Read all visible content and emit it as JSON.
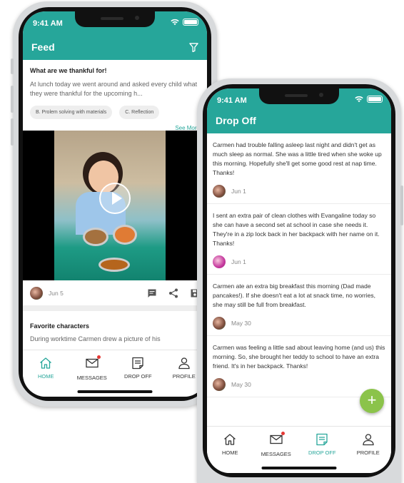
{
  "feed_phone": {
    "status": {
      "time": "9:41 AM"
    },
    "header": {
      "title": "Feed"
    },
    "post1": {
      "title": "What are we thankful for!",
      "body": "At lunch today we went around and asked every child what they were thankful for the upcoming h...",
      "chips": [
        "B. Prolem solving with materials",
        "C. Reflection"
      ],
      "see_more": "See More",
      "date": "Jun 5"
    },
    "post2": {
      "title": "Favorite characters",
      "body": "During worktime Carmen drew a picture of his"
    },
    "tabs": [
      {
        "label": "HOME",
        "icon": "home-icon",
        "active": true
      },
      {
        "label": "MESSAGES",
        "icon": "mail-icon",
        "active": false
      },
      {
        "label": "DROP OFF",
        "icon": "note-icon",
        "active": false
      },
      {
        "label": "PROFILE",
        "icon": "person-icon",
        "active": false
      }
    ]
  },
  "dropoff_phone": {
    "status": {
      "time": "9:41 AM"
    },
    "header": {
      "title": "Drop Off"
    },
    "notes": [
      {
        "text": "Carmen had trouble falling asleep last night and didn't get as much sleep as normal. She was a little tired when she woke up this morning. Hopefully she'll get some good rest at nap time. Thanks!",
        "date": "Jun 1"
      },
      {
        "text": "I sent an extra pair of clean clothes with Evangaline today so she can have a second set at school in case she needs it. They're in a zip lock back in her backpack with her name on it. Thanks!",
        "date": "Jun 1"
      },
      {
        "text": "Carmen ate an extra big breakfast this morning (Dad made pancakes!). If she doesn't eat a lot at snack time, no worries, she may still be full from breakfast.",
        "date": "May 30"
      },
      {
        "text": "Carmen was feeling a little sad about leaving home (and us) this morning. So, she brought her teddy to school to have an extra friend. It's in her backpack. Thanks!",
        "date": "May 30"
      }
    ],
    "fab_label": "+",
    "tabs": [
      {
        "label": "HOME",
        "icon": "home-icon",
        "active": false
      },
      {
        "label": "MESSAGES",
        "icon": "mail-icon",
        "active": false
      },
      {
        "label": "DROP OFF",
        "icon": "note-icon",
        "active": true
      },
      {
        "label": "PROFILE",
        "icon": "person-icon",
        "active": false
      }
    ]
  },
  "colors": {
    "accent": "#26a69a",
    "fab": "#8bc34a",
    "badge": "#e53935"
  }
}
